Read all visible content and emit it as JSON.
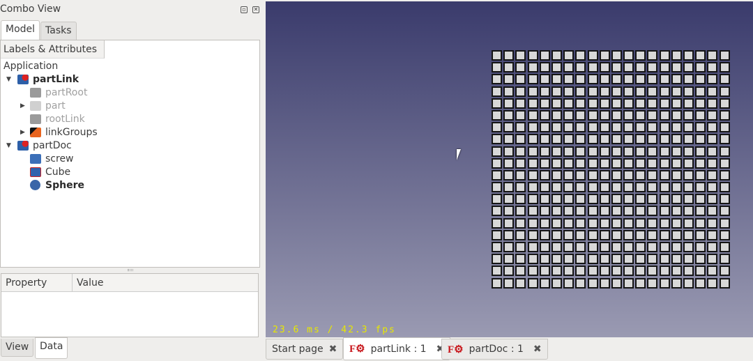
{
  "combo": {
    "title": "Combo View",
    "tabs": [
      "Model",
      "Tasks"
    ]
  },
  "tree": {
    "header": "Labels & Attributes",
    "root": "Application",
    "items": [
      {
        "label": "partLink",
        "icon": "document-icon",
        "expanded": true,
        "bold": true
      },
      {
        "label": "partRoot",
        "icon": "link-icon",
        "dim": true
      },
      {
        "label": "part",
        "icon": "folder-icon",
        "dim": true,
        "collapsed": true
      },
      {
        "label": "rootLink",
        "icon": "link-icon",
        "dim": true
      },
      {
        "label": "linkGroups",
        "icon": "link-group-icon",
        "collapsed": true
      },
      {
        "label": "partDoc",
        "icon": "document-icon",
        "expanded": true
      },
      {
        "label": "screw",
        "icon": "part-icon"
      },
      {
        "label": "Cube",
        "icon": "cube-icon"
      },
      {
        "label": "Sphere",
        "icon": "sphere-icon",
        "bold": true
      }
    ]
  },
  "props": {
    "columns": [
      "Property",
      "Value"
    ]
  },
  "bottom_tabs": [
    "View",
    "Data"
  ],
  "viewport": {
    "fps": "23.6 ms / 42.3 fps",
    "grid_rows": 20,
    "grid_cols": 20
  },
  "doc_tabs": [
    {
      "label": "Start page"
    },
    {
      "label": "partLink : 1",
      "active": true
    },
    {
      "label": "partDoc : 1"
    }
  ],
  "colors": {
    "fps": "#e8e800",
    "bg_top": "#3a3b6c",
    "bg_bottom": "#9a9ab2"
  }
}
